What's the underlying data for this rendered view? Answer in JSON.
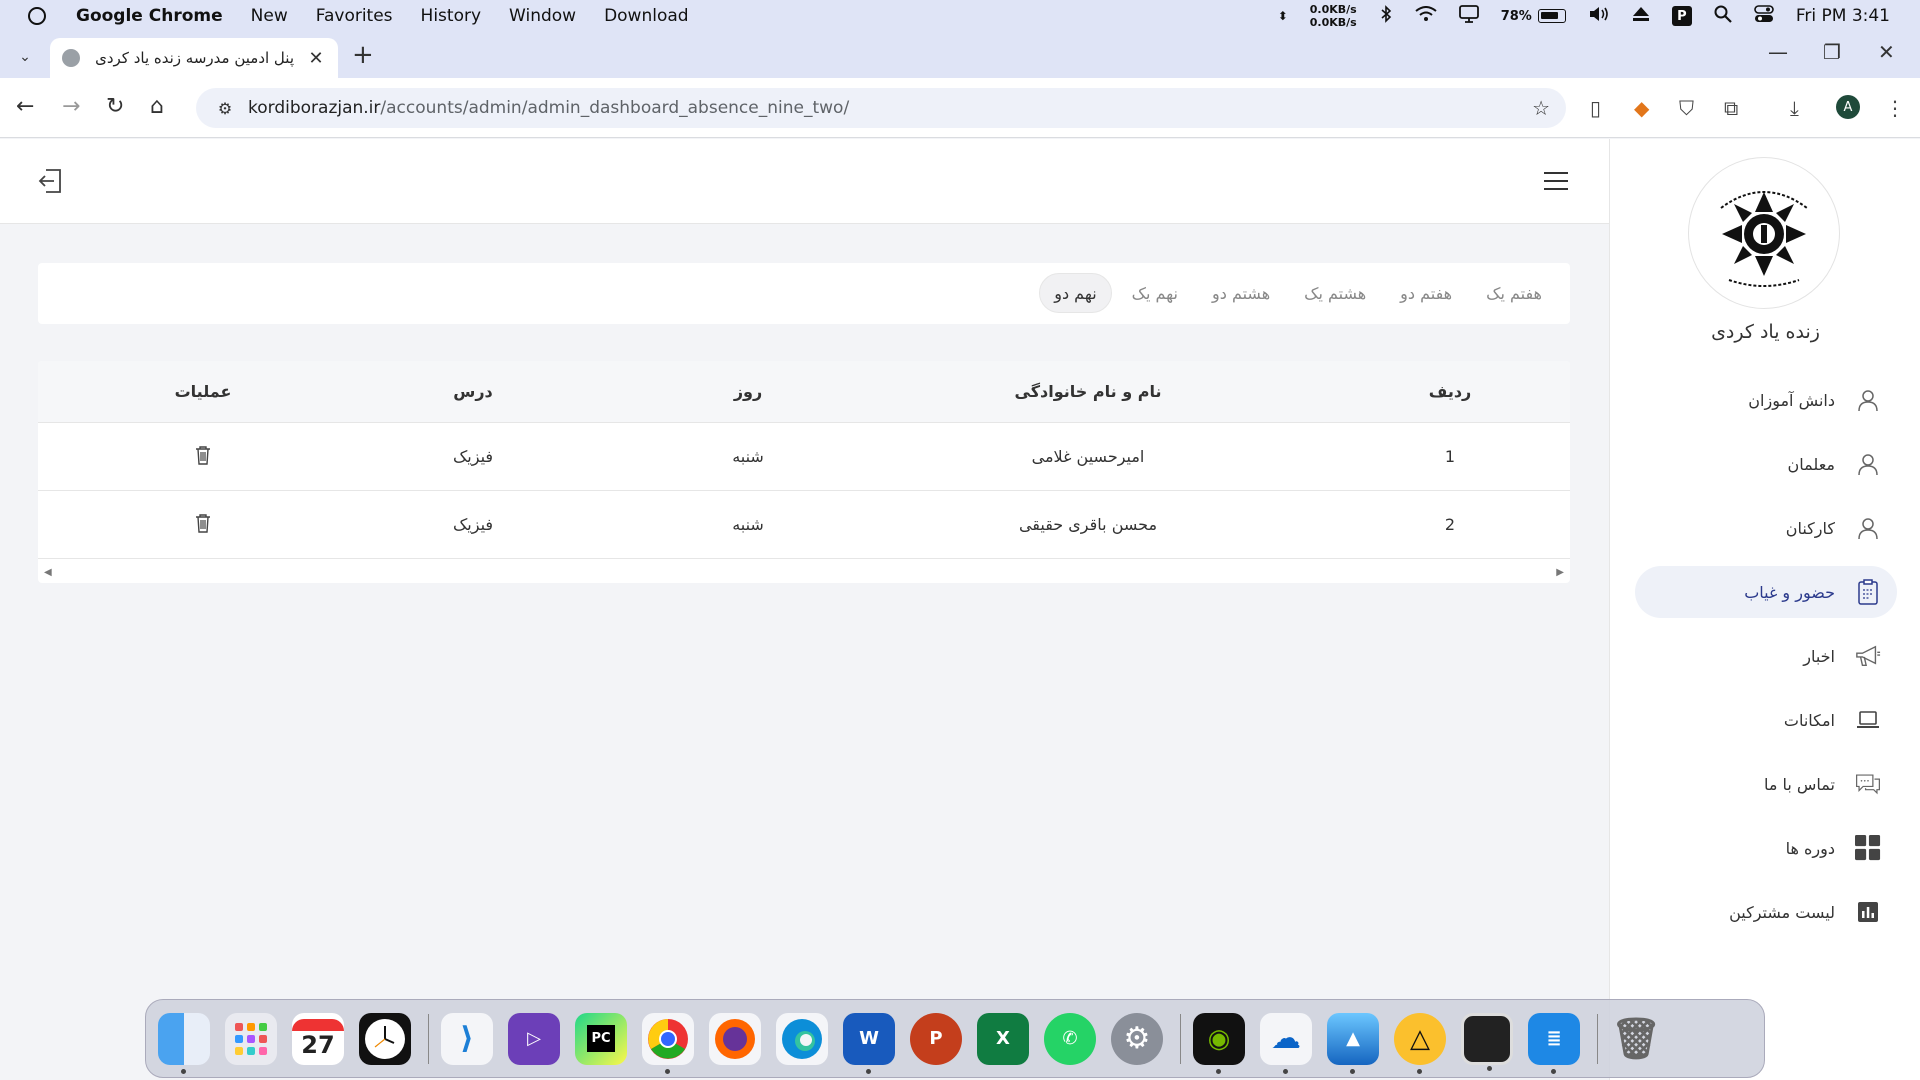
{
  "menubar": {
    "app_name": "Google Chrome",
    "items": [
      "New",
      "Favorites",
      "History",
      "Window",
      "Download"
    ],
    "net_up": "0.0KB/s",
    "net_down": "0.0KB/s",
    "battery": "78%",
    "clock": "Fri PM 3:41"
  },
  "browser": {
    "tab_title": "پنل ادمین مدرسه زنده یاد کردی",
    "url_host": "kordiborazjan.ir",
    "url_path": "/accounts/admin/admin_dashboard_absence_nine_two/",
    "profile_initial": "A"
  },
  "sidebar": {
    "school_name": "زنده یاد کردی",
    "items": [
      {
        "label": "دانش آموزان",
        "icon": "user-icon"
      },
      {
        "label": "معلمان",
        "icon": "user-icon"
      },
      {
        "label": "کارکنان",
        "icon": "user-icon"
      },
      {
        "label": "حضور و غیاب",
        "icon": "clipboard-icon",
        "active": true
      },
      {
        "label": "اخبار",
        "icon": "megaphone-icon"
      },
      {
        "label": "امکانات",
        "icon": "laptop-icon"
      },
      {
        "label": "تماس با ما",
        "icon": "chat-icon"
      },
      {
        "label": "دوره ها",
        "icon": "grid-icon"
      },
      {
        "label": "لیست مشترکین",
        "icon": "bar-chart-icon"
      }
    ]
  },
  "grade_tabs": [
    "هفتم یک",
    "هفتم دو",
    "هشتم یک",
    "هشتم دو",
    "نهم یک",
    "نهم دو"
  ],
  "active_grade_tab": "نهم دو",
  "table": {
    "headers": {
      "radif": "ردیف",
      "name": "نام و نام خانوادگی",
      "day": "روز",
      "course": "درس",
      "ops": "عملیات"
    },
    "rows": [
      {
        "radif": "1",
        "name": "امیرحسین غلامی",
        "day": "شنبه",
        "course": "فیزیک"
      },
      {
        "radif": "2",
        "name": "محسن باقری حقیقی",
        "day": "شنبه",
        "course": "فیزیک"
      }
    ]
  },
  "colors": {
    "accent": "#2b3a8c",
    "active_menu_bg": "#eef1f8",
    "menubar_bg": "#dfe4f6"
  }
}
